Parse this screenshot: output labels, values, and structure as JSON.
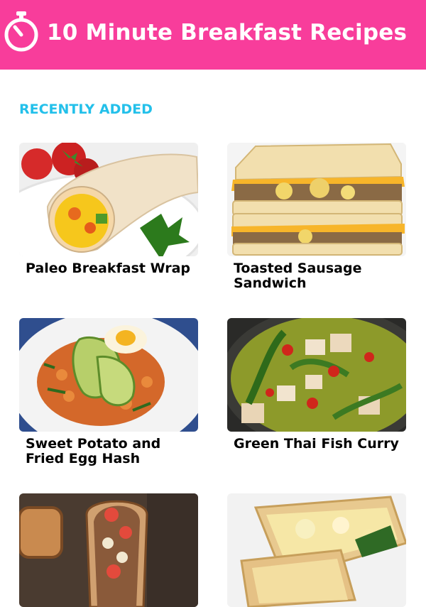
{
  "header": {
    "title": "10 Minute Breakfast Recipes",
    "icon": "stopwatch-icon",
    "background": "#f83d9b"
  },
  "section": {
    "title": "RECENTLY ADDED",
    "color": "#23c0ea"
  },
  "recipes": [
    {
      "title": "Paleo Breakfast Wrap",
      "image": "breakfast-wrap-image"
    },
    {
      "title": "Toasted Sausage Sandwich",
      "image": "sausage-sandwich-image"
    },
    {
      "title": "Sweet Potato and Fried Egg Hash",
      "image": "sweet-potato-hash-image"
    },
    {
      "title": "Green Thai Fish Curry",
      "image": "thai-curry-image"
    },
    {
      "title": "",
      "image": "banana-toast-image"
    },
    {
      "title": "",
      "image": "breakfast-quesadilla-image"
    }
  ]
}
